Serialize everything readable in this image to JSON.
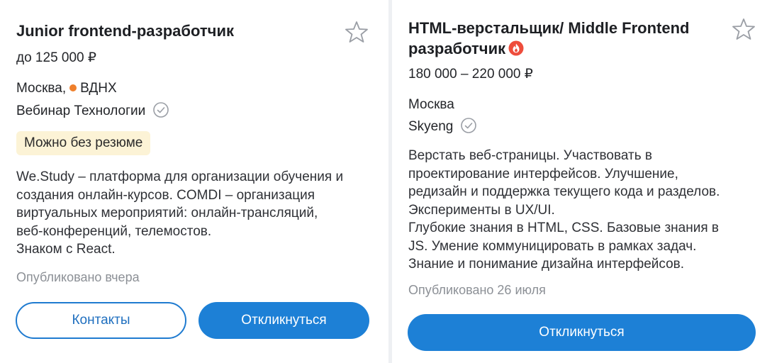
{
  "colors": {
    "accent": "#1d80d6",
    "metro_line": "#ef7f2b",
    "badge_bg": "#fcf3d6",
    "hot_icon": "#ee4d3c",
    "muted_text": "#8c9096"
  },
  "cards": [
    {
      "title": "Junior frontend-разработчик",
      "salary": "до 125 000 ₽",
      "city": "Москва,",
      "metro": "ВДНХ",
      "company": "Вебинар Технологии",
      "badge": "Можно без резюме",
      "description": [
        "We.Study – платформа для организации обучения и",
        "создания онлайн-курсов. COMDI – организация",
        "виртуальных мероприятий: онлайн-трансляций,",
        "веб-конференций, телемостов.",
        "Знаком с React."
      ],
      "published": "Опубликовано вчера",
      "contacts_button": "Контакты",
      "respond_button": "Откликнуться"
    },
    {
      "title_line1": "HTML-верстальщик/ Middle Frontend",
      "title_line2": "разработчик",
      "salary": "180 000 – 220 000 ₽",
      "city": "Москва",
      "company": "Skyeng",
      "description": [
        "Верстать веб-страницы. Участвовать в",
        "проектирование интерфейсов. Улучшение,",
        "редизайн и поддержка текущего кода и разделов.",
        "Эксперименты в UX/UI.",
        "Глубокие знания в HTML, CSS. Базовые знания в",
        "JS. Умение коммуницировать в рамках задач.",
        "Знание и понимание дизайна интерфейсов."
      ],
      "published": "Опубликовано 26 июля",
      "respond_button": "Откликнуться"
    }
  ],
  "icons": {
    "favorite": "star-outline-icon",
    "verified": "check-circle-icon",
    "hot": "fire-icon",
    "metro": "metro-dot-icon"
  }
}
